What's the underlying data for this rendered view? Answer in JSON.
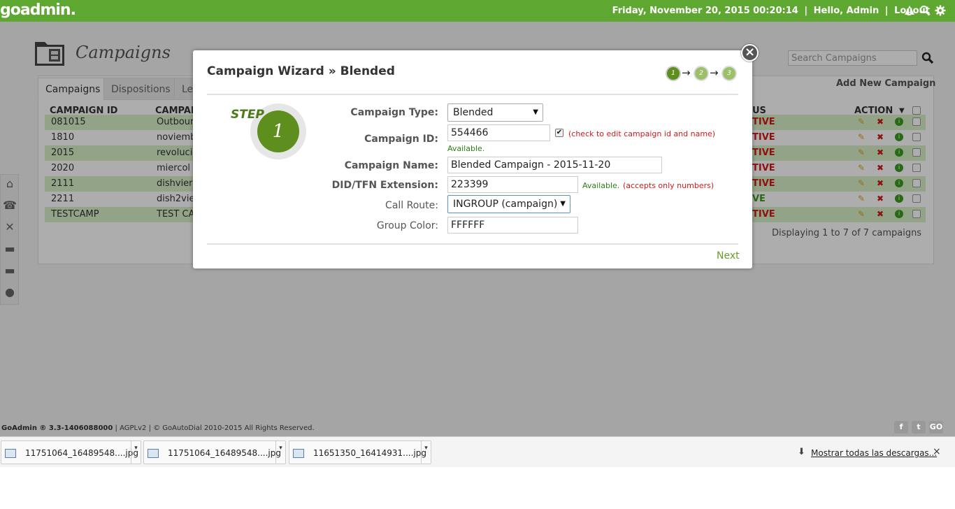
{
  "topbar": {
    "logo": "goadmin.",
    "datetime": "Friday, November 20, 2015 00:20:14",
    "separator": "|",
    "greeting": "Hello, Admin",
    "logout": "Logout",
    "icons": [
      "warning-icon",
      "search-icon",
      "gear-icon"
    ]
  },
  "page": {
    "title": "Campaigns",
    "search_placeholder": "Search Campaigns",
    "tabs": [
      "Campaigns",
      "Dispositions",
      "Le"
    ],
    "add_new": "Add New Campaign",
    "columns": {
      "id": "CAMPAIGN ID",
      "name": "CAMPAI",
      "status": "US",
      "action": "ACTION"
    },
    "action_sort_icon": "▼",
    "rows": [
      {
        "id": "081015",
        "name": "Outbour",
        "status": "TIVE"
      },
      {
        "id": "1810",
        "name": "noviemb",
        "status": "TIVE"
      },
      {
        "id": "2015",
        "name": "revoluci",
        "status": "TIVE"
      },
      {
        "id": "2020",
        "name": "miercol",
        "status": "TIVE"
      },
      {
        "id": "2111",
        "name": "dishvier",
        "status": "TIVE"
      },
      {
        "id": "2211",
        "name": "dish2vie",
        "status": "VE"
      },
      {
        "id": "TESTCAMP",
        "name": "TEST CA",
        "status": "TIVE"
      }
    ],
    "displaying": "Displaying 1 to 7 of 7 campaigns"
  },
  "footer": {
    "version": "GoAdmin ® 3.3-1406088000",
    "license": "| AGPLv2 | © GoAutoDial 2010-2015 All Rights Reserved.",
    "social": [
      "f",
      "t",
      "GO"
    ]
  },
  "downloads": {
    "items": [
      "11751064_16489548....jpg",
      "11751064_16489548....jpg",
      "11651350_16414931....jpg"
    ],
    "show_all": "Mostrar todas las descargas...",
    "close": "×"
  },
  "modal": {
    "title": "Campaign Wizard » Blended",
    "close": "×",
    "steps": [
      "1",
      "2",
      "3"
    ],
    "step_arrow": "→",
    "step_label": "STEP",
    "step_number": "1",
    "fields": {
      "campaign_type": {
        "label": "Campaign Type:",
        "value": "Blended"
      },
      "campaign_id": {
        "label": "Campaign ID:",
        "value": "554466",
        "note": "(check to edit campaign id and name)",
        "available": "Available."
      },
      "campaign_name": {
        "label": "Campaign Name:",
        "value": "Blended Campaign - 2015-11-20"
      },
      "did_extension": {
        "label": "DID/TFN Extension:",
        "value": "223399",
        "available": "Available.",
        "note": "(accepts only numbers)"
      },
      "call_route": {
        "label": "Call Route:",
        "value": "INGROUP (campaign)"
      },
      "group_color": {
        "label": "Group Color:",
        "value": "FFFFFF"
      }
    },
    "next": "Next"
  },
  "colors": {
    "brand_green": "#5ea832",
    "status_red": "#d31919",
    "available_green": "#2f7f17",
    "step_green": "#5e8e1d"
  }
}
